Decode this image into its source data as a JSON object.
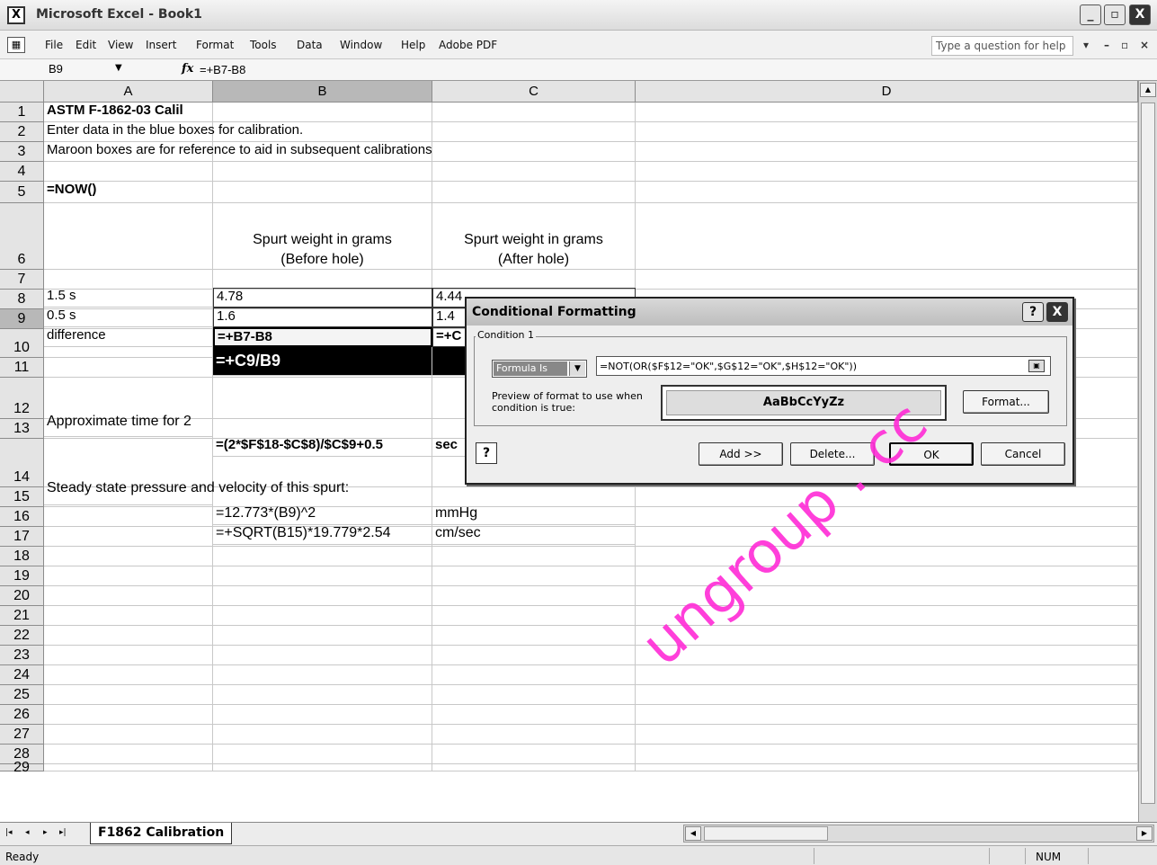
{
  "window": {
    "title": "Microsoft Excel - Book1",
    "app_icon": "X",
    "controls": [
      "_",
      "▫",
      "X"
    ]
  },
  "menu": {
    "doc_icon": "▦",
    "items": [
      "File",
      "Edit",
      "View",
      "Insert",
      "Format",
      "Tools",
      "Data",
      "Window",
      "Help",
      "Adobe PDF"
    ],
    "help_placeholder": "Type a question for help",
    "doc_controls": [
      "▾",
      "–",
      "▫",
      "×"
    ]
  },
  "formula_bar": {
    "name_box": "B9",
    "fx": "fx",
    "formula": "=+B7-B8"
  },
  "columns": [
    "A",
    "B",
    "C",
    "D"
  ],
  "rows": [
    "1",
    "2",
    "3",
    "4",
    "5",
    "6",
    "7",
    "8",
    "9",
    "10",
    "11",
    "12",
    "13",
    "14",
    "15",
    "16",
    "17",
    "18",
    "19",
    "20",
    "21",
    "22",
    "23",
    "24",
    "25",
    "26",
    "27",
    "28",
    "29"
  ],
  "cells": {
    "a1": "ASTM F-1862-03 Calil",
    "a2": "Enter data in the blue boxes for calibration.",
    "a3": "Maroon boxes are for reference to aid in subsequent calibrations",
    "a5": "=NOW()",
    "b6_line1": "Spurt weight in grams",
    "b6_line2": "(Before hole)",
    "c6_line1": "Spurt weight in grams",
    "c6_line2": "(After hole)",
    "a7": "1.5 s",
    "b7": "4.78",
    "c7": "4.44",
    "a8": "0.5 s",
    "b8": "1.6",
    "c8": "1.4",
    "a9": "difference",
    "b9": "=+B7-B8",
    "c9": "=+C",
    "b10": "=+C9/B9",
    "a12": "Approximate time for 2",
    "b13": "=(2*$F$18-$C$8)/$C$9+0.5",
    "c13": "sec",
    "a14": "Steady state pressure and velocity of this spurt:",
    "b15": "=12.773*(B9)^2",
    "c15": "mmHg",
    "b16": "=+SQRT(B15)*19.779*2.54",
    "c16": "cm/sec"
  },
  "dialog": {
    "title": "Conditional Formatting",
    "help_btn": "?",
    "close_btn": "X",
    "group_label": "Condition 1",
    "condition_type": "Formula Is",
    "condition_formula": "=NOT(OR($F$12=\"OK\",$G$12=\"OK\",$H$12=\"OK\"))",
    "preview_label": "Preview of format to use when condition is true:",
    "preview_text": "AaBbCcYyZz",
    "format_btn": "Format...",
    "add_btn": "Add >>",
    "delete_btn": "Delete...",
    "ok_btn": "OK",
    "cancel_btn": "Cancel",
    "help_icon": "?"
  },
  "sheet_tabs": {
    "active": "F1862 Calibration",
    "nav": [
      "|◂",
      "◂",
      "▸",
      "▸|"
    ]
  },
  "status": {
    "ready": "Ready",
    "num": "NUM"
  },
  "watermark": "ungroup . cc"
}
